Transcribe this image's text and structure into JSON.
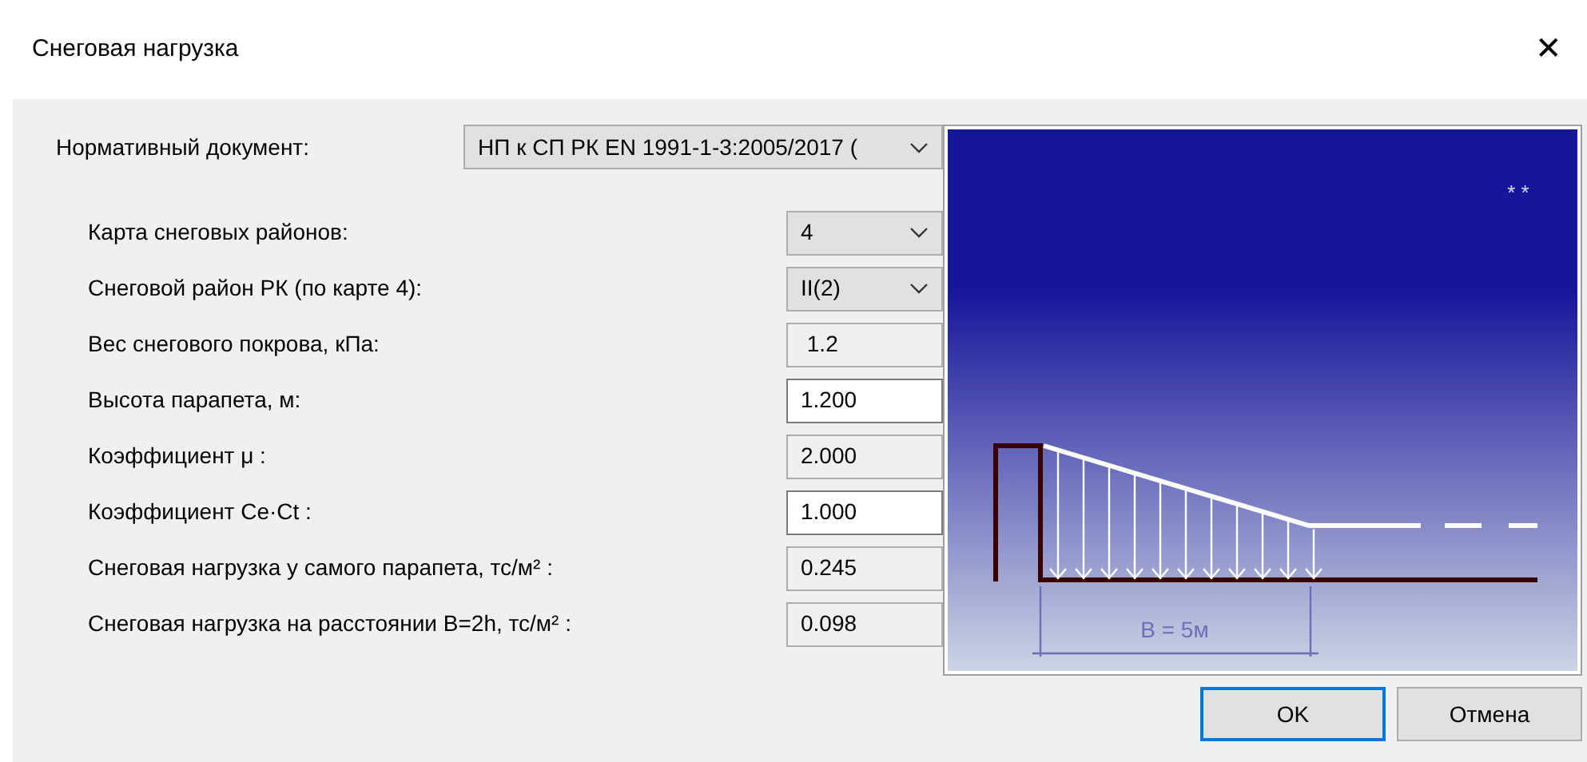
{
  "window": {
    "title": "Снеговая нагрузка",
    "close": "✕"
  },
  "document": {
    "label": "Нормативный документ:",
    "value": "НП к СП РК EN 1991-1-3:2005/2017 ("
  },
  "fields": [
    {
      "label": "Карта снеговых районов:",
      "kind": "select",
      "value": "4",
      "disabled": false
    },
    {
      "label": "Снеговой район РК (по карте 4):",
      "kind": "select",
      "value": "II(2)",
      "disabled": false
    },
    {
      "label": "Вес снегового покрова, кПа:",
      "kind": "input",
      "value": " 1.2",
      "disabled": true
    },
    {
      "label": "Высота парапета, м:",
      "kind": "input",
      "value": "1.200",
      "disabled": false
    },
    {
      "label": "Коэффициент μ :",
      "kind": "input",
      "value": "2.000",
      "disabled": true
    },
    {
      "label": "Коэффициент Ce·Ct :",
      "kind": "input",
      "value": "1.000",
      "disabled": false
    },
    {
      "label": "Снеговая нагрузка у самого парапета, тс/м² :",
      "kind": "input",
      "value": "0.245",
      "disabled": true
    },
    {
      "label": "Снеговая нагрузка на расстоянии B=2h, тс/м² :",
      "kind": "input",
      "value": "0.098",
      "disabled": true
    }
  ],
  "diagram": {
    "mark": "* *",
    "dimension": "B = 5м"
  },
  "buttons": [
    {
      "label": "OK",
      "selected": true
    },
    {
      "label": "Отмена",
      "selected": false
    }
  ]
}
